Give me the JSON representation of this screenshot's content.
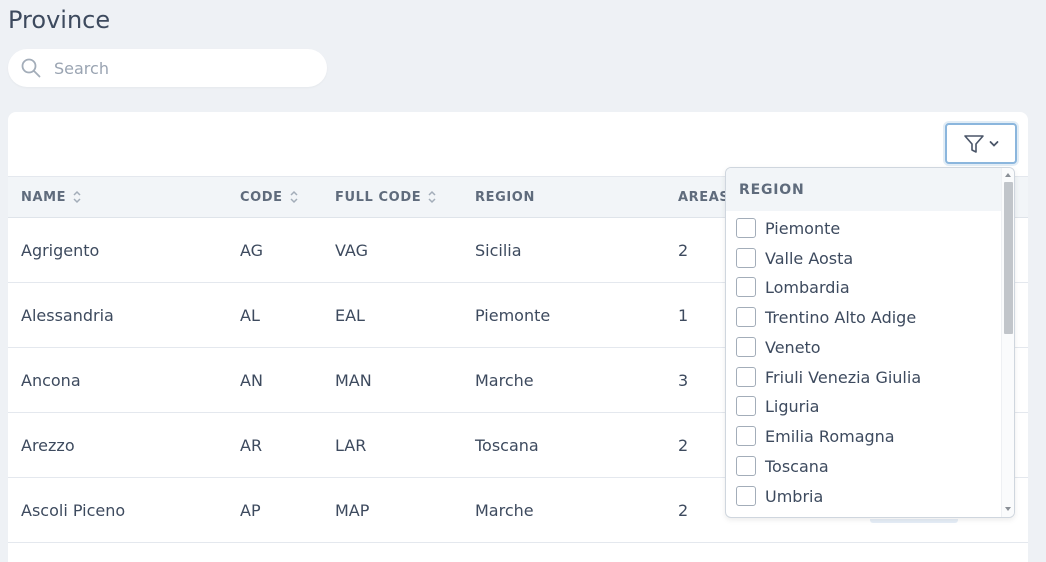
{
  "page": {
    "title": "Province"
  },
  "search": {
    "placeholder": "Search",
    "value": ""
  },
  "table": {
    "columns": [
      {
        "label": "NAME",
        "sortable": true
      },
      {
        "label": "CODE",
        "sortable": true
      },
      {
        "label": "FULL CODE",
        "sortable": true
      },
      {
        "label": "REGION",
        "sortable": false
      },
      {
        "label": "AREAS",
        "sortable": false
      }
    ],
    "rows": [
      {
        "name": "Agrigento",
        "code": "AG",
        "full_code": "VAG",
        "region": "Sicilia",
        "areas": "2"
      },
      {
        "name": "Alessandria",
        "code": "AL",
        "full_code": "EAL",
        "region": "Piemonte",
        "areas": "1"
      },
      {
        "name": "Ancona",
        "code": "AN",
        "full_code": "MAN",
        "region": "Marche",
        "areas": "3"
      },
      {
        "name": "Arezzo",
        "code": "AR",
        "full_code": "LAR",
        "region": "Toscana",
        "areas": "2"
      },
      {
        "name": "Ascoli Piceno",
        "code": "AP",
        "full_code": "MAP",
        "region": "Marche",
        "areas": "2"
      }
    ]
  },
  "filter_dropdown": {
    "header": "REGION",
    "options": [
      {
        "label": "Piemonte",
        "checked": false
      },
      {
        "label": "Valle Aosta",
        "checked": false
      },
      {
        "label": "Lombardia",
        "checked": false
      },
      {
        "label": "Trentino Alto Adige",
        "checked": false
      },
      {
        "label": "Veneto",
        "checked": false
      },
      {
        "label": "Friuli Venezia Giulia",
        "checked": false
      },
      {
        "label": "Liguria",
        "checked": false
      },
      {
        "label": "Emilia Romagna",
        "checked": false
      },
      {
        "label": "Toscana",
        "checked": false
      },
      {
        "label": "Umbria",
        "checked": false
      }
    ]
  },
  "icons": {
    "search": "search-icon",
    "filter": "filter-icon",
    "chevron": "chevron-down-icon",
    "sort": "sort-icon"
  },
  "colors": {
    "background": "#eef1f5",
    "card": "#ffffff",
    "header_bg": "#f2f5f8",
    "text": "#3d4a5e",
    "muted": "#5f6b7c",
    "accent_border": "#8bb6dd"
  }
}
